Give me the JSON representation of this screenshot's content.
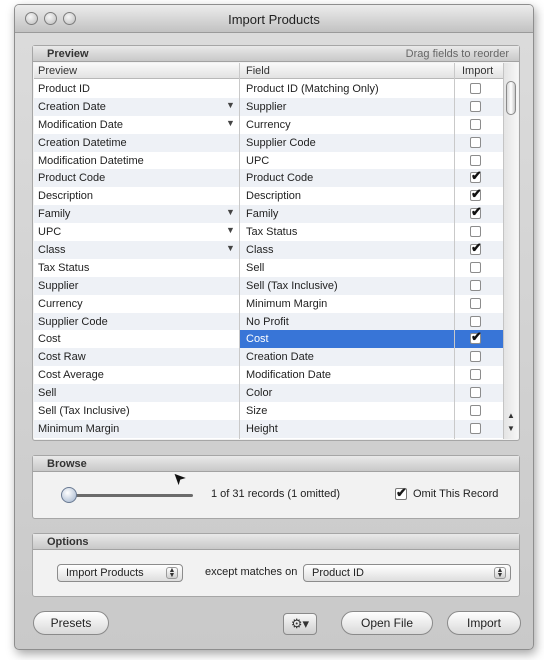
{
  "window": {
    "title": "Import Products"
  },
  "preview_panel": {
    "title": "Preview",
    "hint": "Drag fields to reorder",
    "columns": {
      "preview": "Preview",
      "field": "Field",
      "import": "Import"
    },
    "rows": [
      {
        "preview": "Product ID",
        "arrow": false,
        "field": "Product ID (Matching Only)",
        "checked": false
      },
      {
        "preview": "Creation Date",
        "arrow": true,
        "field": "Supplier",
        "checked": false
      },
      {
        "preview": "Modification Date",
        "arrow": true,
        "field": "Currency",
        "checked": false
      },
      {
        "preview": "Creation Datetime",
        "arrow": false,
        "field": "Supplier Code",
        "checked": false
      },
      {
        "preview": "Modification Datetime",
        "arrow": false,
        "field": "UPC",
        "checked": false
      },
      {
        "preview": "Product Code",
        "arrow": false,
        "field": "Product Code",
        "checked": true
      },
      {
        "preview": "Description",
        "arrow": false,
        "field": "Description",
        "checked": true
      },
      {
        "preview": "Family",
        "arrow": true,
        "field": "Family",
        "checked": true
      },
      {
        "preview": "UPC",
        "arrow": true,
        "field": "Tax Status",
        "checked": false
      },
      {
        "preview": "Class",
        "arrow": true,
        "field": "Class",
        "checked": true
      },
      {
        "preview": "Tax Status",
        "arrow": false,
        "field": "Sell",
        "checked": false
      },
      {
        "preview": "Supplier",
        "arrow": false,
        "field": "Sell (Tax Inclusive)",
        "checked": false
      },
      {
        "preview": "Currency",
        "arrow": false,
        "field": "Minimum Margin",
        "checked": false
      },
      {
        "preview": "Supplier Code",
        "arrow": false,
        "field": "No Profit",
        "checked": false
      },
      {
        "preview": "Cost",
        "arrow": false,
        "field": "Cost",
        "checked": true,
        "selected": true
      },
      {
        "preview": "Cost Raw",
        "arrow": false,
        "field": "Creation Date",
        "checked": false
      },
      {
        "preview": "Cost Average",
        "arrow": false,
        "field": "Modification Date",
        "checked": false
      },
      {
        "preview": "Sell",
        "arrow": false,
        "field": "Color",
        "checked": false
      },
      {
        "preview": "Sell (Tax Inclusive)",
        "arrow": false,
        "field": "Size",
        "checked": false
      },
      {
        "preview": "Minimum Margin",
        "arrow": false,
        "field": "Height",
        "checked": false
      }
    ]
  },
  "browse_panel": {
    "title": "Browse",
    "record_text": "1 of 31 records (1 omitted)",
    "omit_label": "Omit This Record",
    "omit_checked": true
  },
  "options_panel": {
    "title": "Options",
    "mode_value": "Import Products",
    "except_text": "except matches on",
    "match_value": "Product ID"
  },
  "buttons": {
    "presets": "Presets",
    "gear": "⚙▾",
    "open_file": "Open File",
    "import": "Import"
  },
  "icons": {
    "check": "✔",
    "arrow_down": "▼",
    "scroll_up": "▲",
    "scroll_down": "▼",
    "popup": "▲▼",
    "cursor": "➤"
  }
}
